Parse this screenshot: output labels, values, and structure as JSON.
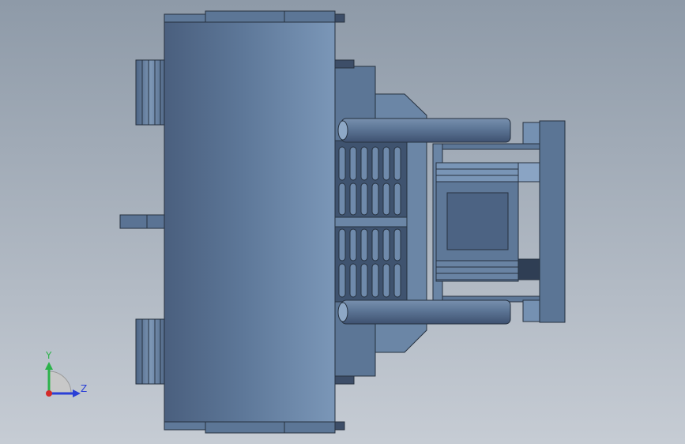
{
  "triad": {
    "y_label": "Y",
    "z_label": "Z"
  },
  "colors": {
    "background_top": "#8e9aa8",
    "background_bottom": "#c6ccd4",
    "drum_dark": "#4f6584",
    "drum_light": "#7b96b6",
    "part_mid": "#5e7896",
    "part_light": "#6c86a6",
    "edge": "#26313f",
    "y_axis": "#2bb24a",
    "z_axis": "#2a3fd6",
    "x_axis": "#d42a2a"
  }
}
